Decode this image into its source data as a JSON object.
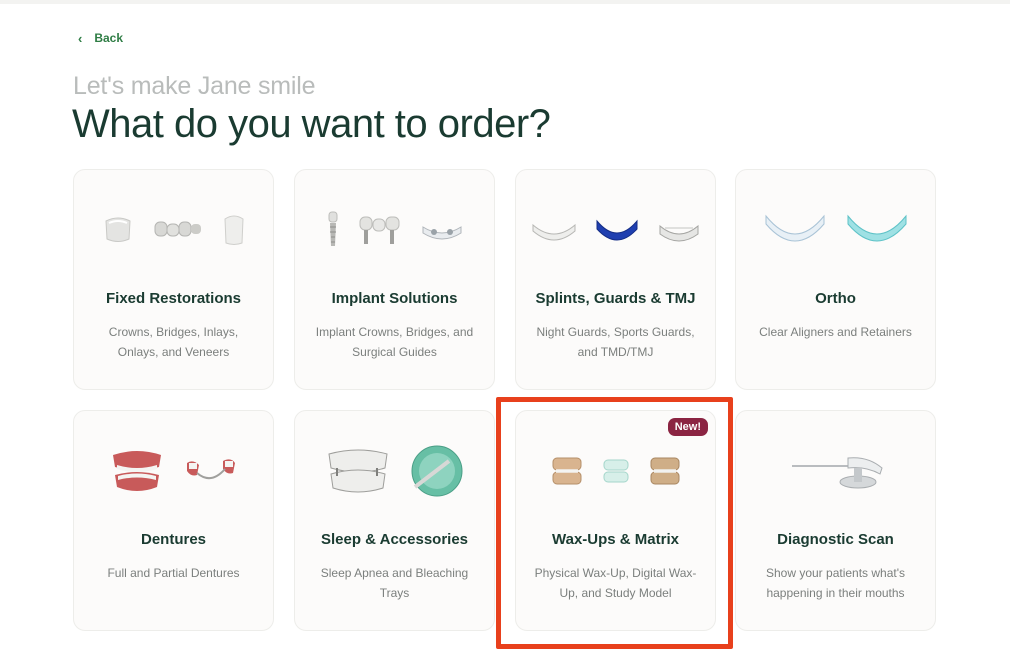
{
  "nav": {
    "back_label": "Back"
  },
  "header": {
    "subtitle": "Let's make Jane smile",
    "title": "What do you want to order?"
  },
  "cards": [
    {
      "name": "Fixed Restorations",
      "desc": "Crowns, Bridges, Inlays, Onlays, and Veneers"
    },
    {
      "name": "Implant Solutions",
      "desc": "Implant Crowns, Bridges, and Surgical Guides"
    },
    {
      "name": "Splints, Guards & TMJ",
      "desc": "Night Guards, Sports Guards, and TMD/TMJ"
    },
    {
      "name": "Ortho",
      "desc": "Clear Aligners and Retainers"
    },
    {
      "name": "Dentures",
      "desc": "Full and Partial Dentures"
    },
    {
      "name": "Sleep & Accessories",
      "desc": "Sleep Apnea and Bleaching Trays"
    },
    {
      "name": "Wax-Ups & Matrix",
      "desc": "Physical Wax-Up, Digital Wax-Up, and Study Model",
      "badge": "New!"
    },
    {
      "name": "Diagnostic Scan",
      "desc": "Show your patients what's happening in their mouths"
    }
  ],
  "colors": {
    "accent_green": "#2f7d45",
    "title_dark_green": "#1a3b31",
    "badge_maroon": "#8b2442",
    "highlight_red": "#e8401c"
  },
  "icons": [
    "back-chevron-icon",
    "crown-icon",
    "bridge-icon",
    "veneer-icon",
    "implant-icon",
    "aligner-icon",
    "night-guard-icon",
    "denture-icon",
    "bleaching-tray-icon",
    "wax-up-model-icon",
    "intraoral-scanner-icon"
  ]
}
